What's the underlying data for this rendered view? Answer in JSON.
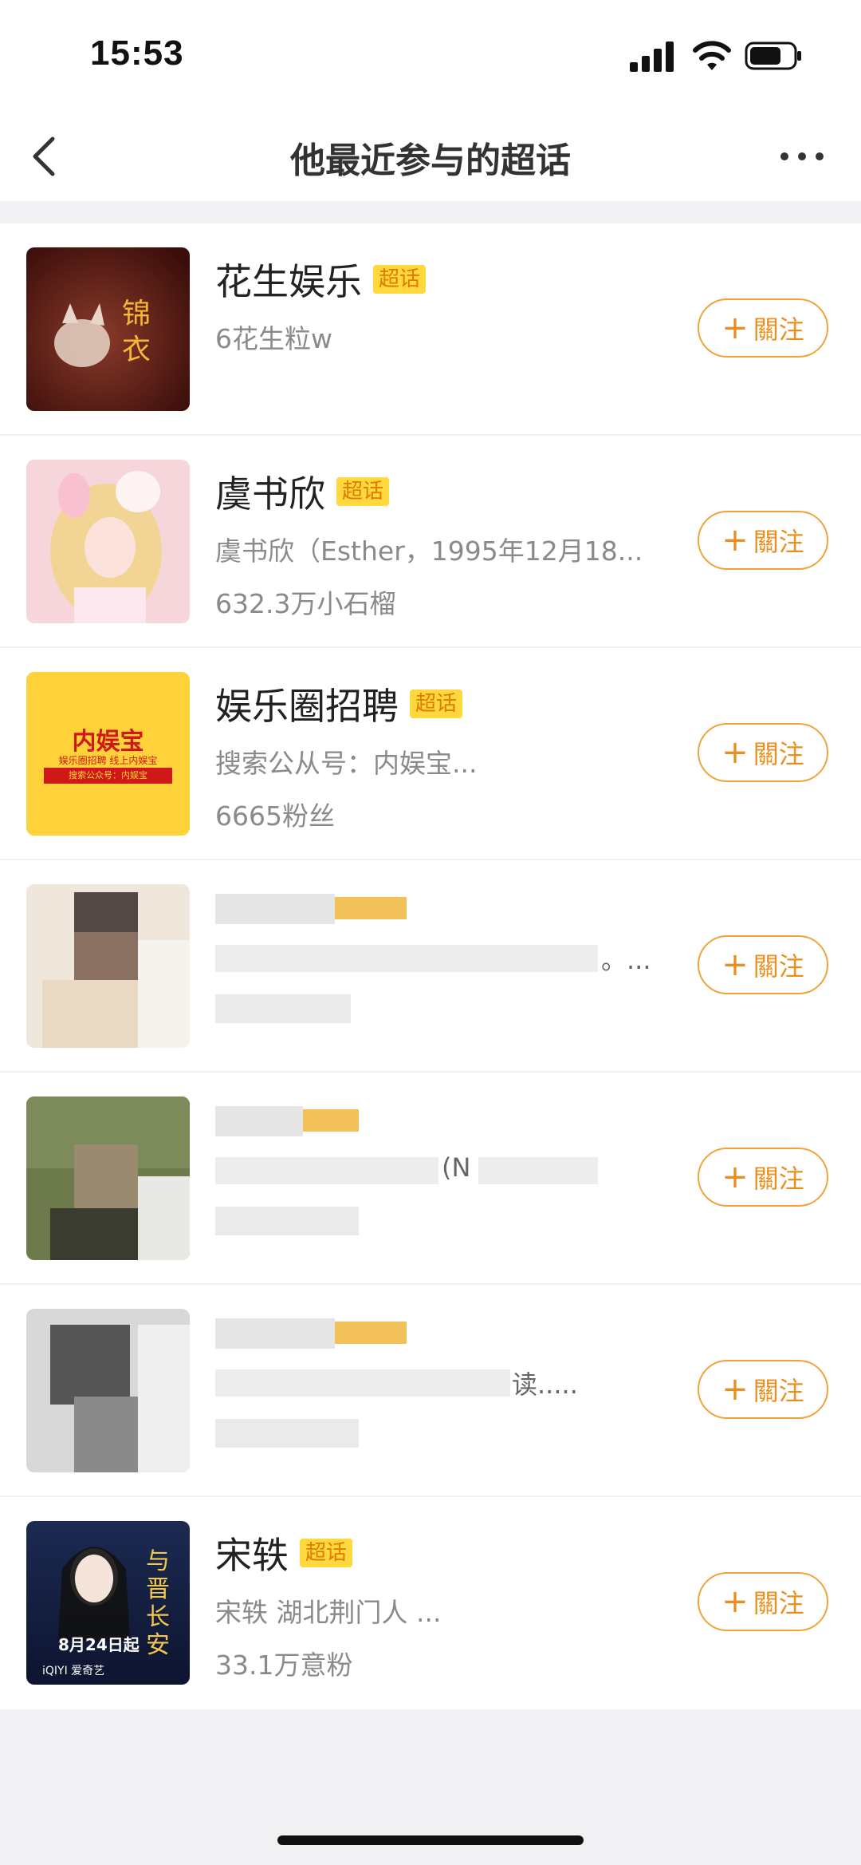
{
  "status_bar": {
    "time": "15:53"
  },
  "nav": {
    "title": "他最近参与的超话"
  },
  "follow_label": "關注",
  "items": [
    {
      "name": "花生娱乐",
      "tag": "超话",
      "line1": "6花生粒w",
      "line2": ""
    },
    {
      "name": "虞书欣",
      "tag": "超话",
      "line1": "虞书欣（Esther，1995年12月18...",
      "line2": "632.3万小石榴"
    },
    {
      "name": "娱乐圈招聘",
      "tag": "超话",
      "line1": "搜索公从号：内娱宝...",
      "line2": "6665粉丝",
      "thumb_text": "内娱宝",
      "thumb_sub": "娱乐圈招聘 线上内娱宝",
      "thumb_banner": "搜索公众号：内娱宝"
    },
    {
      "blurred": true,
      "line1_tail": "。..."
    },
    {
      "blurred": true,
      "line1_tail": "(N"
    },
    {
      "blurred": true,
      "line1_tail": "读....."
    },
    {
      "name": "宋轶",
      "tag": "超话",
      "line1": "宋轶 湖北荆门人 ...",
      "line2": "33.1万意粉",
      "poster_title": "与晋长安",
      "poster_date": "8月24日起",
      "poster_brand": "iQIYI 爱奇艺"
    }
  ],
  "colors": {
    "accent": "#f1a33b",
    "tag_bg": "#ffd83d",
    "tag_text": "#e07a00"
  }
}
